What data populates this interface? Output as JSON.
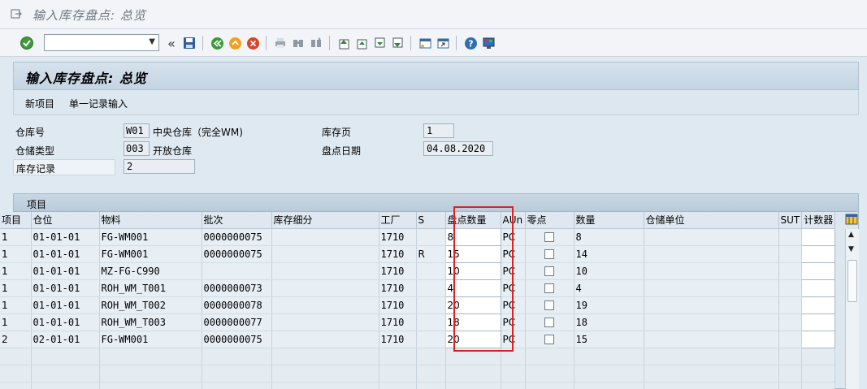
{
  "title": "输入库存盘点: 总览",
  "toolbar": {
    "command_value": "",
    "icons": [
      "enter-icon",
      "save-icon",
      "back-icon",
      "exit-icon",
      "cancel-icon",
      "print-icon",
      "find-icon",
      "find-next-icon",
      "first-page-icon",
      "prev-page-icon",
      "next-page-icon",
      "last-page-icon",
      "new-session-icon",
      "shortcut-icon",
      "help-icon",
      "customize-layout-icon"
    ]
  },
  "screen": {
    "heading": "输入库存盘点: 总览",
    "actions": {
      "new_item": "新项目",
      "single_entry": "单一记录输入"
    }
  },
  "header": {
    "warehouse_label": "仓库号",
    "warehouse_value": "W01",
    "warehouse_desc": "中央仓库（完全WM)",
    "storage_type_label": "仓储类型",
    "storage_type_value": "003",
    "storage_type_desc": "开放仓库",
    "inventory_record_label": "库存记录",
    "inventory_record_value": "2",
    "inventory_page_label": "库存页",
    "inventory_page_value": "1",
    "count_date_label": "盘点日期",
    "count_date_value": "04.08.2020"
  },
  "table": {
    "title": "项目",
    "columns": [
      "项目",
      "仓位",
      "物料",
      "批次",
      "库存细分",
      "工厂",
      "S",
      "盘点数量",
      "AUn",
      "零点",
      "数量",
      "仓储单位",
      "SUT",
      "计数器"
    ],
    "rows": [
      [
        "1",
        "01-01-01",
        "FG-WM001",
        "0000000075",
        "",
        "1710",
        "",
        "8",
        "PC",
        "",
        "8",
        "",
        "",
        ""
      ],
      [
        "1",
        "01-01-01",
        "FG-WM001",
        "0000000075",
        "",
        "1710",
        "R",
        "15",
        "PC",
        "",
        "14",
        "",
        "",
        ""
      ],
      [
        "1",
        "01-01-01",
        "MZ-FG-C990",
        "",
        "",
        "1710",
        "",
        "10",
        "PC",
        "",
        "10",
        "",
        "",
        ""
      ],
      [
        "1",
        "01-01-01",
        "ROH_WM_T001",
        "0000000073",
        "",
        "1710",
        "",
        "4",
        "PC",
        "",
        "4",
        "",
        "",
        ""
      ],
      [
        "1",
        "01-01-01",
        "ROH_WM_T002",
        "0000000078",
        "",
        "1710",
        "",
        "20",
        "PC",
        "",
        "19",
        "",
        "",
        ""
      ],
      [
        "1",
        "01-01-01",
        "ROH_WM_T003",
        "0000000077",
        "",
        "1710",
        "",
        "18",
        "PC",
        "",
        "18",
        "",
        "",
        ""
      ],
      [
        "2",
        "02-01-01",
        "FG-WM001",
        "0000000075",
        "",
        "1710",
        "",
        "20",
        "PC",
        "",
        "15",
        "",
        "",
        ""
      ]
    ]
  },
  "colors": {
    "highlight": "#e02020",
    "accent": "#c4d4e2"
  }
}
